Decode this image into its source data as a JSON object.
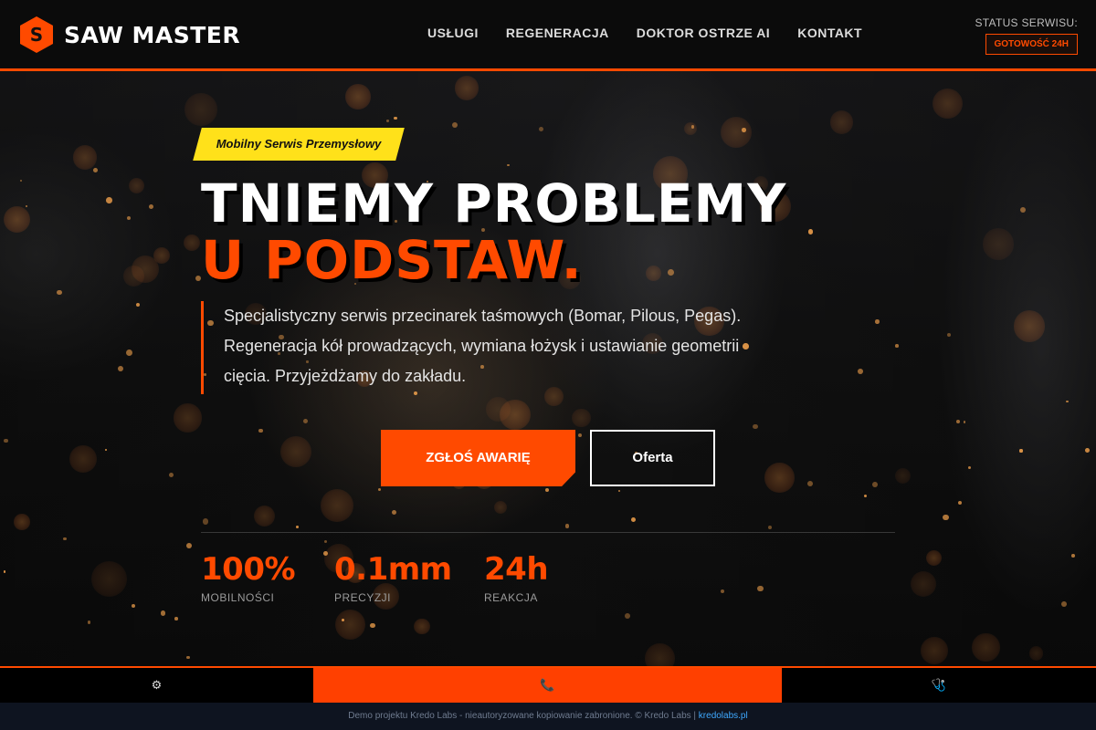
{
  "brand": {
    "name": "SAW MASTER",
    "logo_letter": "S",
    "accent": "#ff4a00"
  },
  "nav": [
    {
      "label": "USŁUGI"
    },
    {
      "label": "REGENERACJA"
    },
    {
      "label": "DOKTOR OSTRZE AI"
    },
    {
      "label": "KONTAKT"
    }
  ],
  "status": {
    "label": "STATUS SERWISU:",
    "badge": "GOTOWOŚĆ 24H"
  },
  "hero": {
    "tag": "Mobilny Serwis Przemysłowy",
    "title_line1": "TNIEMY PROBLEMY",
    "title_line2": "U PODSTAW.",
    "lead": "Specjalistyczny serwis przecinarek taśmowych (Bomar, Pilous, Pegas). Regeneracja kół prowadzących, wymiana łożysk i ustawianie geometrii cięcia. Przyjeżdżamy do zakładu.",
    "primary_button": "ZGŁOŚ AWARIĘ",
    "secondary_button": "Oferta"
  },
  "stats": [
    {
      "value": "100%",
      "label": "MOBILNOŚCI"
    },
    {
      "value": "0.1mm",
      "label": "PRECYZJI"
    },
    {
      "value": "24h",
      "label": "REAKCJA"
    }
  ],
  "bottom_bar": [
    {
      "icon": "gear-icon",
      "glyph": "⚙"
    },
    {
      "icon": "phone-icon",
      "glyph": "📞"
    },
    {
      "icon": "stethoscope-icon",
      "glyph": "🩺"
    }
  ],
  "footer": {
    "text": "Demo projektu Kredo Labs - nieautoryzowane kopiowanie zabronione. © Kredo Labs | ",
    "link": "kredolabs.pl"
  }
}
